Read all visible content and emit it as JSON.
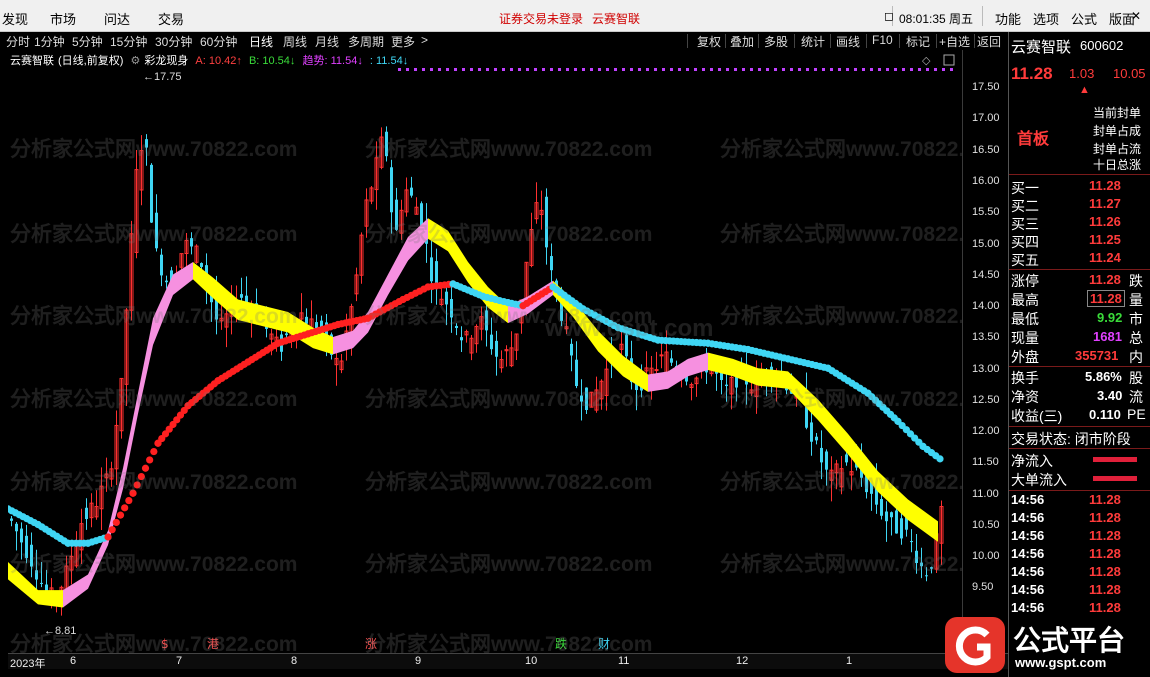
{
  "menu": {
    "items": [
      "发现",
      "市场",
      "问达",
      "交易"
    ],
    "login_status": "证券交易未登录",
    "broker": "云赛智联",
    "clock": "08:01:35 周五",
    "right_items": [
      "功能",
      "选项",
      "公式",
      "版面"
    ]
  },
  "toolbar": {
    "periods": [
      "分时",
      "1分钟",
      "5分钟",
      "15分钟",
      "30分钟",
      "60分钟",
      "日线",
      "周线",
      "月线",
      "多周期",
      "更多"
    ],
    "active": "日线",
    "right": [
      "复权",
      "叠加",
      "多股",
      "统计",
      "画线",
      "F10",
      "标记",
      "+自选",
      "返回"
    ]
  },
  "legend": {
    "stock": "云赛智联",
    "mode": "(日线,前复权)",
    "indicator": "彩龙现身",
    "a": "A: 10.42",
    "b": "B: 10.54",
    "trend": "趋势: 11.54",
    "d": ": 11.54"
  },
  "chart_data": {
    "type": "candlestick",
    "title": "云赛智联 (日线,前复权)",
    "y_axis": [
      "17.50",
      "17.00",
      "16.50",
      "16.00",
      "15.50",
      "15.00",
      "14.50",
      "14.00",
      "13.50",
      "13.00",
      "12.50",
      "12.00",
      "11.50",
      "11.00",
      "10.50",
      "10.00",
      "9.50"
    ],
    "ylim": [
      9.2,
      17.9
    ],
    "x_labels": [
      "2023年",
      "6",
      "7",
      "8",
      "9",
      "10",
      "11",
      "12",
      "1"
    ],
    "annotations": {
      "high": "17.75",
      "low": "8.81"
    },
    "markers": [
      "$",
      "港",
      "涨",
      "跌",
      "财"
    ],
    "series": [
      {
        "name": "A",
        "last": 10.42,
        "color": "#ffff00"
      },
      {
        "name": "B",
        "last": 10.54,
        "color": "#ff9ee0"
      },
      {
        "name": "趋势",
        "last": 11.54,
        "color": "#3fd6f4"
      }
    ],
    "close_path": [
      [
        0,
        10.6
      ],
      [
        20,
        10.0
      ],
      [
        40,
        9.3
      ],
      [
        55,
        9.6
      ],
      [
        70,
        10.5
      ],
      [
        85,
        10.8
      ],
      [
        100,
        11.3
      ],
      [
        112,
        12.7
      ],
      [
        118,
        14.2
      ],
      [
        128,
        16.3
      ],
      [
        135,
        16.8
      ],
      [
        145,
        14.9
      ],
      [
        160,
        14.3
      ],
      [
        175,
        15.0
      ],
      [
        190,
        14.8
      ],
      [
        210,
        13.6
      ],
      [
        230,
        14.2
      ],
      [
        250,
        13.8
      ],
      [
        270,
        13.3
      ],
      [
        290,
        13.9
      ],
      [
        310,
        13.6
      ],
      [
        330,
        13.0
      ],
      [
        345,
        14.2
      ],
      [
        355,
        15.5
      ],
      [
        365,
        16.1
      ],
      [
        375,
        16.8
      ],
      [
        385,
        15.0
      ],
      [
        395,
        15.9
      ],
      [
        410,
        15.5
      ],
      [
        425,
        14.3
      ],
      [
        440,
        14.0
      ],
      [
        455,
        13.4
      ],
      [
        470,
        13.8
      ],
      [
        490,
        13.1
      ],
      [
        505,
        13.4
      ],
      [
        520,
        15.0
      ],
      [
        530,
        15.8
      ],
      [
        540,
        14.6
      ],
      [
        555,
        13.7
      ],
      [
        565,
        12.8
      ],
      [
        580,
        12.4
      ],
      [
        595,
        12.9
      ],
      [
        610,
        13.4
      ],
      [
        625,
        12.7
      ],
      [
        640,
        12.9
      ],
      [
        655,
        13.2
      ],
      [
        670,
        13.0
      ],
      [
        685,
        12.8
      ],
      [
        700,
        13.1
      ],
      [
        715,
        12.6
      ],
      [
        730,
        12.9
      ],
      [
        745,
        12.7
      ],
      [
        760,
        13.0
      ],
      [
        775,
        12.8
      ],
      [
        790,
        12.5
      ],
      [
        805,
        11.8
      ],
      [
        820,
        11.2
      ],
      [
        835,
        11.5
      ],
      [
        850,
        11.3
      ],
      [
        865,
        10.9
      ],
      [
        880,
        10.5
      ],
      [
        895,
        10.4
      ],
      [
        905,
        10.1
      ],
      [
        915,
        9.7
      ],
      [
        922,
        9.9
      ],
      [
        930,
        10.4
      ],
      [
        935,
        11.2
      ]
    ],
    "ribbon": [
      [
        0,
        9.9,
        9.75
      ],
      [
        30,
        9.45,
        9.35
      ],
      [
        55,
        9.45,
        9.3
      ],
      [
        80,
        9.7,
        9.6
      ],
      [
        100,
        10.4,
        10.3
      ],
      [
        115,
        11.4,
        11.2
      ],
      [
        130,
        12.6,
        12.4
      ],
      [
        145,
        13.8,
        13.5
      ],
      [
        165,
        14.5,
        14.3
      ],
      [
        185,
        14.7,
        14.55
      ],
      [
        205,
        14.45,
        14.25
      ],
      [
        230,
        14.1,
        13.9
      ],
      [
        255,
        14.0,
        13.8
      ],
      [
        280,
        13.9,
        13.7
      ],
      [
        305,
        13.65,
        13.45
      ],
      [
        325,
        13.5,
        13.35
      ],
      [
        345,
        13.6,
        13.45
      ],
      [
        360,
        13.9,
        13.7
      ],
      [
        380,
        14.5,
        14.3
      ],
      [
        400,
        15.1,
        14.85
      ],
      [
        420,
        15.4,
        15.2
      ],
      [
        440,
        15.2,
        15.0
      ],
      [
        460,
        14.7,
        14.5
      ],
      [
        480,
        14.3,
        14.1
      ],
      [
        500,
        14.0,
        13.85
      ],
      [
        520,
        14.15,
        14.0
      ],
      [
        545,
        14.4,
        14.3
      ],
      [
        565,
        14.1,
        13.95
      ],
      [
        590,
        13.6,
        13.4
      ],
      [
        615,
        13.2,
        13.0
      ],
      [
        640,
        12.9,
        12.75
      ],
      [
        660,
        12.95,
        12.8
      ],
      [
        680,
        13.15,
        13.0
      ],
      [
        700,
        13.25,
        13.1
      ],
      [
        725,
        13.15,
        13.0
      ],
      [
        750,
        13.0,
        12.85
      ],
      [
        780,
        12.95,
        12.8
      ],
      [
        810,
        12.5,
        12.3
      ],
      [
        840,
        11.95,
        11.75
      ],
      [
        870,
        11.35,
        11.15
      ],
      [
        900,
        10.9,
        10.7
      ],
      [
        930,
        10.55,
        10.35
      ]
    ],
    "cyan_line": [
      [
        0,
        10.75
      ],
      [
        30,
        10.5
      ],
      [
        60,
        10.2
      ],
      [
        80,
        10.2
      ],
      [
        100,
        10.3
      ]
    ],
    "red_line": [
      [
        100,
        10.3
      ],
      [
        125,
        11.0
      ],
      [
        150,
        11.8
      ],
      [
        180,
        12.4
      ],
      [
        210,
        12.8
      ],
      [
        240,
        13.1
      ],
      [
        270,
        13.4
      ],
      [
        300,
        13.55
      ],
      [
        330,
        13.7
      ],
      [
        360,
        13.8
      ],
      [
        395,
        14.1
      ],
      [
        420,
        14.3
      ],
      [
        445,
        14.35
      ]
    ],
    "cyan_line2": [
      [
        445,
        14.35
      ],
      [
        475,
        14.15
      ],
      [
        500,
        14.05
      ],
      [
        515,
        14.0
      ]
    ],
    "red_line2": [
      [
        515,
        14.0
      ],
      [
        530,
        14.15
      ],
      [
        545,
        14.3
      ]
    ],
    "cyan_line3": [
      [
        545,
        14.3
      ],
      [
        575,
        13.95
      ],
      [
        610,
        13.65
      ],
      [
        650,
        13.45
      ],
      [
        700,
        13.4
      ],
      [
        740,
        13.3
      ],
      [
        780,
        13.15
      ],
      [
        820,
        13.0
      ],
      [
        860,
        12.6
      ],
      [
        890,
        12.15
      ],
      [
        915,
        11.75
      ],
      [
        932,
        11.55
      ]
    ]
  },
  "panel": {
    "name": "云赛智联",
    "code": "600602",
    "price": "11.28",
    "change": "1.03",
    "pct": "10.05",
    "tag": "首板",
    "seal_lines": [
      "当前封单",
      "封单占成",
      "封单占流",
      "十日总涨"
    ],
    "bids": [
      {
        "label": "买一",
        "price": "11.28"
      },
      {
        "label": "买二",
        "price": "11.27"
      },
      {
        "label": "买三",
        "price": "11.26"
      },
      {
        "label": "买四",
        "price": "11.25"
      },
      {
        "label": "买五",
        "price": "11.24"
      }
    ],
    "stats": [
      {
        "label": "涨停",
        "value": "11.28",
        "right": "跌"
      },
      {
        "label": "最高",
        "value": "11.28",
        "right": "量"
      },
      {
        "label": "最低",
        "value": "9.92",
        "right": "市"
      },
      {
        "label": "现量",
        "value": "1681",
        "right": "总"
      },
      {
        "label": "外盘",
        "value": "355731",
        "right": "内"
      },
      {
        "label": "换手",
        "value": "5.86%",
        "right": "股"
      },
      {
        "label": "净资",
        "value": "3.40",
        "right": "流"
      },
      {
        "label": "收益(三)",
        "value": "0.110",
        "right": "PE"
      }
    ],
    "trade_state": "交易状态: 闭市阶段",
    "flows": [
      "净流入",
      "大单流入"
    ],
    "ticks": [
      {
        "time": "14:56",
        "price": "11.28"
      },
      {
        "time": "14:56",
        "price": "11.28"
      },
      {
        "time": "14:56",
        "price": "11.28"
      },
      {
        "time": "14:56",
        "price": "11.28"
      },
      {
        "time": "14:56",
        "price": "11.28"
      },
      {
        "time": "14:56",
        "price": "11.28"
      },
      {
        "time": "14:56",
        "price": "11.28"
      }
    ]
  },
  "watermarks": {
    "text": "分析家公式网www.70822.com",
    "site": "www.gspt.com"
  },
  "logo": {
    "text": "公式平台",
    "url": "www.gspt.com"
  }
}
